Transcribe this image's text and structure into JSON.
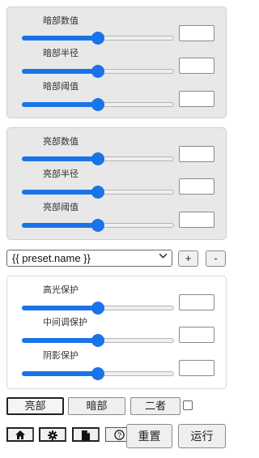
{
  "dark_panel": {
    "rows": [
      {
        "label": "暗部数值",
        "value": "",
        "slider_fraction": 0.5
      },
      {
        "label": "暗部半径",
        "value": "",
        "slider_fraction": 0.5
      },
      {
        "label": "暗部阈值",
        "value": "",
        "slider_fraction": 0.5
      }
    ]
  },
  "light_panel": {
    "rows": [
      {
        "label": "亮部数值",
        "value": "",
        "slider_fraction": 0.5
      },
      {
        "label": "亮部半径",
        "value": "",
        "slider_fraction": 0.5
      },
      {
        "label": "亮部阈值",
        "value": "",
        "slider_fraction": 0.5
      }
    ]
  },
  "preset": {
    "selected": "{{ preset.name }}",
    "add_label": "+",
    "remove_label": "-"
  },
  "protect_panel": {
    "rows": [
      {
        "label": "高光保护",
        "value": "",
        "slider_fraction": 0.5
      },
      {
        "label": "中间调保护",
        "value": "",
        "slider_fraction": 0.5
      },
      {
        "label": "阴影保护",
        "value": "",
        "slider_fraction": 0.5
      }
    ]
  },
  "mode_tabs": {
    "light": "亮部",
    "dark": "暗部",
    "both": "二者",
    "active": "light",
    "both_checked": false
  },
  "toolbar": {
    "icons": [
      "home-icon",
      "gear-icon",
      "file-icon",
      "help-icon"
    ],
    "reset_label": "重置",
    "run_label": "运行"
  },
  "colors": {
    "accent": "#1a73e8",
    "panel_gray": "#e8e8e8"
  }
}
